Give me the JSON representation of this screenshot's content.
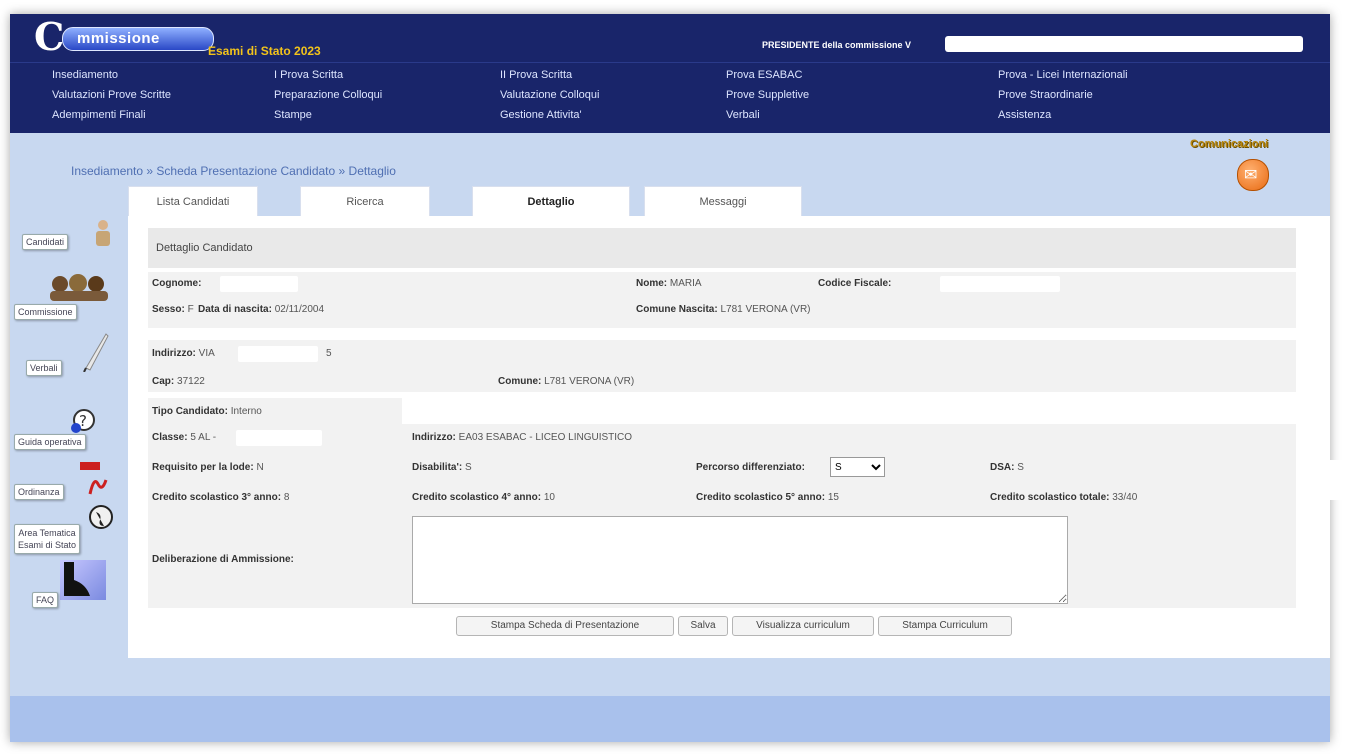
{
  "header": {
    "logo_text": "mmissione",
    "logo_letter": "C",
    "exam_title": "Esami di Stato 2023",
    "president_label": "PRESIDENTE della commissione V",
    "colors": {
      "nav_bg": "#19256a",
      "title_yellow": "#f2c31b",
      "page_bg": "#c8d8f0"
    }
  },
  "menu": [
    [
      "Insediamento",
      "I Prova Scritta",
      "II Prova Scritta",
      "Prova ESABAC",
      "Prova - Licei Internazionali"
    ],
    [
      "Valutazioni Prove Scritte",
      "Preparazione Colloqui",
      "Valutazione Colloqui",
      "Prove Suppletive",
      "Prove Straordinarie"
    ],
    [
      "Adempimenti Finali",
      "Stampe",
      "Gestione Attivita'",
      "Verbali",
      "Assistenza"
    ]
  ],
  "breadcrumb": "Insediamento » Scheda Presentazione Candidato » Dettaglio",
  "comunicazioni": {
    "label": "Comunicazioni",
    "icon": "envelope-icon"
  },
  "tabs": [
    "Lista Candidati",
    "Ricerca",
    "Dettaglio",
    "Messaggi"
  ],
  "active_tab": "Dettaglio",
  "section_title": "Dettaglio Candidato",
  "fields": {
    "cognome": {
      "label": "Cognome:",
      "value": ""
    },
    "nome": {
      "label": "Nome:",
      "value": "MARIA"
    },
    "codice_fiscale": {
      "label": "Codice Fiscale:",
      "value": ""
    },
    "sesso": {
      "label": "Sesso:",
      "value": "F"
    },
    "data_nascita": {
      "label": "Data di nascita:",
      "value": "02/11/2004"
    },
    "comune_nascita": {
      "label": "Comune Nascita:",
      "value": "L781 VERONA (VR)"
    },
    "indirizzo": {
      "label": "Indirizzo:",
      "value": "VIA",
      "civico": "5"
    },
    "cap": {
      "label": "Cap:",
      "value": "37122"
    },
    "comune": {
      "label": "Comune:",
      "value": "L781 VERONA (VR)"
    },
    "tipo_candidato": {
      "label": "Tipo Candidato:",
      "value": "Interno"
    },
    "classe": {
      "label": "Classe:",
      "value": "5 AL -"
    },
    "indirizzo_studi": {
      "label": "Indirizzo:",
      "value": "EA03 ESABAC - LICEO LINGUISTICO"
    },
    "requisito_lode": {
      "label": "Requisito per la lode:",
      "value": "N"
    },
    "disabilita": {
      "label": "Disabilita':",
      "value": "S"
    },
    "percorso_diff": {
      "label": "Percorso differenziato:",
      "value": "S",
      "options": [
        "S"
      ]
    },
    "dsa": {
      "label": "DSA:",
      "value": "S"
    },
    "credito_3": {
      "label": "Credito scolastico 3° anno:",
      "value": "8"
    },
    "credito_4": {
      "label": "Credito scolastico 4° anno:",
      "value": "10"
    },
    "credito_5": {
      "label": "Credito scolastico 5° anno:",
      "value": "15"
    },
    "credito_tot": {
      "label": "Credito scolastico totale:",
      "value": "33/40"
    },
    "deliberazione": {
      "label": "Deliberazione di Ammissione:",
      "value": ""
    }
  },
  "buttons": [
    "Stampa Scheda di Presentazione",
    "Salva",
    "Visualizza curriculum",
    "Stampa Curriculum"
  ],
  "sidebar": [
    {
      "label": "Candidati",
      "icon": "person-icon"
    },
    {
      "label": "Commissione",
      "icon": "group-icon"
    },
    {
      "label": "Verbali",
      "icon": "quill-pen-icon"
    },
    {
      "label": "Guida operativa",
      "icon": "help-icon"
    },
    {
      "label": "Ordinanza",
      "icon": "pdf-icon"
    },
    {
      "label": "Area Tematica",
      "label2": "Esami di Stato",
      "icon": "globe-icon"
    },
    {
      "label": "FAQ",
      "icon": "faq-icon"
    }
  ]
}
